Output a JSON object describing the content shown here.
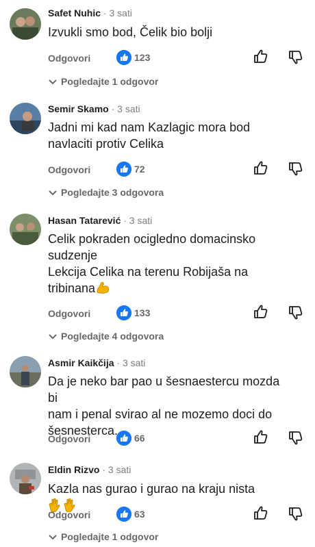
{
  "comments": [
    {
      "name": "Safet Nuhic",
      "time": "· 3 sati",
      "text_lines": [
        "Izvukli smo bod, Čelik bio bolji"
      ],
      "reply_label": "Odgovori",
      "likes": "123",
      "view_replies": "Pogledajte 1 odgovor",
      "avatar_colors": [
        "#6b7a5a",
        "#3d4a33"
      ]
    },
    {
      "name": "Semir Skamo",
      "time": "· 3 sati",
      "text_lines": [
        "Jadni mi kad nam Kazlagic mora bod",
        "navlaciti protiv Celika"
      ],
      "reply_label": "Odgovori",
      "likes": "72",
      "view_replies": "Pogledajte 3 odgovora",
      "avatar_colors": [
        "#5a7fa6",
        "#2f4660"
      ]
    },
    {
      "name": "Hasan Tatarević",
      "time": "· 3 sati",
      "text_lines": [
        "Celik pokraden ocigledno domacinsko",
        "sudzenje",
        "Lekcija Celika na terenu Robijaša na",
        "tribinana"
      ],
      "emoji_after_last_line": "flexed-biceps",
      "reply_label": "Odgovori",
      "likes": "133",
      "view_replies": "Pogledajte 4 odgovora",
      "avatar_colors": [
        "#7d8f6a",
        "#4a5a3c"
      ]
    },
    {
      "name": "Asmir Kaikčija",
      "time": "· 3 sati",
      "text_lines": [
        "Da je neko bar pao u šesnaestercu mozda bi",
        "nam i penal svirao al ne mozemo doci do",
        "šesnesterca...."
      ],
      "reply_label": "Odgovori",
      "likes": "66",
      "avatar_colors": [
        "#8a9fb0",
        "#3c4652"
      ]
    },
    {
      "name": "Eldin Rizvo",
      "time": "· 3 sati",
      "text_lines": [
        "Kazla nas gurao i gurao na kraju nista"
      ],
      "emoji_after_last_line": "clapping-hands-x2",
      "reply_label": "Odgovori",
      "likes": "63",
      "view_replies": "Pogledajte 1 odgovor",
      "avatar_colors": [
        "#b0b5b8",
        "#5d4a3a"
      ]
    }
  ],
  "colors": {
    "like_blue": "#1877f2",
    "secondary_text": "#65676b",
    "timestamp": "#7a7d82"
  },
  "icons": {
    "like_badge": "thumbs-up-icon",
    "like_button": "thumbs-up-outline-icon",
    "dislike_button": "thumbs-down-outline-icon",
    "expand": "chevron-down-icon"
  }
}
